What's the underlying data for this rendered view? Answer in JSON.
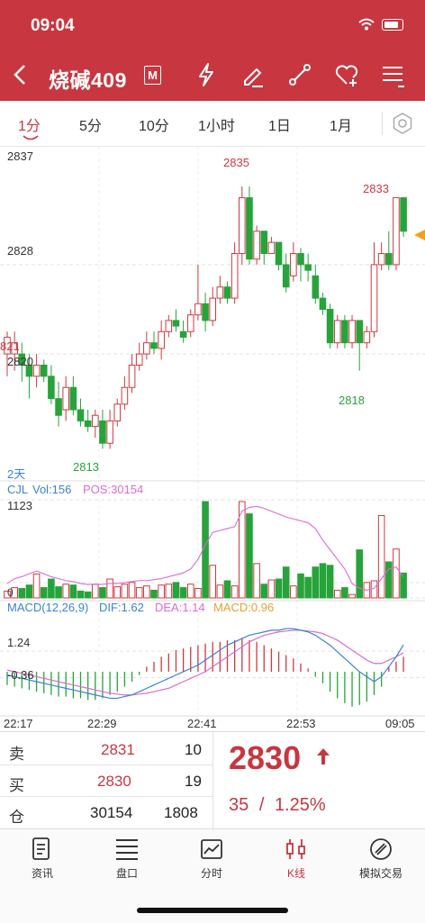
{
  "status": {
    "time": "09:04"
  },
  "header": {
    "title": "烧碱409",
    "badge": "M"
  },
  "tabs": [
    "1分",
    "5分",
    "10分",
    "1小时",
    "1日",
    "1月"
  ],
  "chart": {
    "price_ticks": [
      "2837",
      "2828",
      "2820"
    ],
    "left_cut_label": "821",
    "high1": "2835",
    "high2": "2833",
    "low1": "2813",
    "low2": "2818",
    "period_label": "2天",
    "vol_legend": {
      "name": "CJL",
      "vol": "Vol:156",
      "pos": "POS:30154"
    },
    "vol_max": "1123",
    "vol_zero": "0",
    "macd_legend": {
      "name": "MACD(12,26,9)",
      "dif": "DIF:1.62",
      "dea": "DEA:1.14",
      "macd": "MACD:0.96"
    },
    "macd_ticks": [
      "1.24",
      "-0.36"
    ],
    "time_labels": [
      "22:17",
      "22:29",
      "22:41",
      "22:53",
      "09:05"
    ]
  },
  "chart_data": {
    "type": "candlestick",
    "price_range": [
      2810,
      2838
    ],
    "candles": [
      [
        2820,
        2821.5,
        2818,
        2822
      ],
      [
        2820,
        2821,
        2818.5,
        2822
      ],
      [
        2820,
        2819,
        2817.5,
        2821
      ],
      [
        2819,
        2818,
        2816,
        2820
      ],
      [
        2818,
        2819,
        2817,
        2820
      ],
      [
        2819,
        2818,
        2817.5,
        2819.5
      ],
      [
        2818,
        2816,
        2815.5,
        2819
      ],
      [
        2816,
        2814.5,
        2813.5,
        2817.5
      ],
      [
        2815,
        2817,
        2814,
        2818
      ],
      [
        2817,
        2815,
        2814.5,
        2818
      ],
      [
        2815,
        2814,
        2813.5,
        2816
      ],
      [
        2814,
        2813.5,
        2813,
        2815
      ],
      [
        2813.5,
        2814.5,
        2812.5,
        2815
      ],
      [
        2814,
        2812,
        2811.5,
        2815
      ],
      [
        2812,
        2814,
        2811.5,
        2815
      ],
      [
        2814,
        2815.5,
        2813.5,
        2816
      ],
      [
        2815.5,
        2817,
        2815,
        2818
      ],
      [
        2817,
        2819,
        2816.5,
        2820
      ],
      [
        2819,
        2820,
        2818.5,
        2821
      ],
      [
        2820,
        2821,
        2819.5,
        2822
      ],
      [
        2821,
        2820.5,
        2820,
        2822
      ],
      [
        2820.5,
        2822,
        2819.5,
        2823
      ],
      [
        2822,
        2823,
        2821.5,
        2823.5
      ],
      [
        2823,
        2822.5,
        2822,
        2824
      ],
      [
        2822,
        2821.5,
        2821,
        2823
      ],
      [
        2822,
        2823.5,
        2821.5,
        2824
      ],
      [
        2823.5,
        2824.5,
        2823,
        2828
      ],
      [
        2824.5,
        2823,
        2822,
        2825.5
      ],
      [
        2823,
        2825,
        2822.5,
        2826
      ],
      [
        2825,
        2826,
        2824.5,
        2827
      ],
      [
        2826,
        2825,
        2824.5,
        2826.5
      ],
      [
        2825,
        2829,
        2824.5,
        2830
      ],
      [
        2829,
        2834,
        2828,
        2835
      ],
      [
        2834,
        2828.5,
        2828,
        2835
      ],
      [
        2828.5,
        2831,
        2828,
        2831.5
      ],
      [
        2831,
        2829,
        2828,
        2831
      ],
      [
        2829,
        2830,
        2829,
        2830.5
      ],
      [
        2830,
        2828,
        2827.5,
        2830
      ],
      [
        2828,
        2826,
        2825.5,
        2829
      ],
      [
        2827,
        2829,
        2826.5,
        2830
      ],
      [
        2829,
        2828,
        2826.5,
        2829.5
      ],
      [
        2828,
        2827.5,
        2826.5,
        2829
      ],
      [
        2827,
        2825,
        2824.5,
        2828
      ],
      [
        2825,
        2824,
        2823.5,
        2825.5
      ],
      [
        2824,
        2821,
        2820.5,
        2824.5
      ],
      [
        2821,
        2823,
        2820.5,
        2823.5
      ],
      [
        2823,
        2821,
        2820.5,
        2823.5
      ],
      [
        2821,
        2823,
        2820.5,
        2823.5
      ],
      [
        2823,
        2821,
        2818.5,
        2823
      ],
      [
        2821,
        2822,
        2820.5,
        2822.5
      ],
      [
        2822,
        2828,
        2821.5,
        2830
      ],
      [
        2828,
        2829,
        2827.5,
        2830
      ],
      [
        2829,
        2828,
        2827.5,
        2831
      ],
      [
        2828,
        2834,
        2827.5,
        2834
      ],
      [
        2834,
        2831,
        2830.5,
        2834
      ]
    ],
    "volumes": [
      80,
      120,
      110,
      150,
      280,
      120,
      220,
      130,
      160,
      150,
      80,
      70,
      160,
      120,
      220,
      130,
      160,
      180,
      120,
      140,
      90,
      150,
      160,
      180,
      120,
      160,
      110,
      1123,
      380,
      150,
      200,
      140,
      1123,
      980,
      400,
      160,
      210,
      220,
      360,
      140,
      280,
      240,
      360,
      400,
      380,
      90,
      120,
      40,
      560,
      180,
      200,
      960,
      420,
      570,
      290
    ],
    "macd_hist": [
      -0.8,
      -0.9,
      -1.0,
      -1.1,
      -1.2,
      -1.3,
      -1.4,
      -1.5,
      -1.5,
      -1.6,
      -1.6,
      -1.7,
      -1.7,
      -1.6,
      -1.4,
      -1.2,
      -0.9,
      -0.6,
      -0.2,
      0.3,
      0.6,
      0.9,
      1.1,
      1.3,
      1.4,
      1.5,
      1.6,
      1.7,
      1.8,
      1.8,
      1.9,
      1.9,
      2.0,
      1.9,
      1.8,
      1.6,
      1.4,
      1.2,
      1.0,
      0.8,
      0.5,
      0.2,
      -0.3,
      -0.7,
      -1.2,
      -1.6,
      -1.9,
      -2.1,
      -2.0,
      -1.8,
      -1.4,
      -0.9,
      0.3,
      0.6,
      0.9
    ],
    "dif": [
      -0.2,
      -0.3,
      -0.4,
      -0.5,
      -0.6,
      -0.7,
      -0.8,
      -0.9,
      -1.0,
      -1.1,
      -1.2,
      -1.3,
      -1.4,
      -1.5,
      -1.6,
      -1.6,
      -1.5,
      -1.4,
      -1.2,
      -1.0,
      -0.8,
      -0.6,
      -0.4,
      -0.2,
      0.0,
      0.2,
      0.4,
      0.7,
      1.0,
      1.3,
      1.6,
      1.8,
      2.0,
      2.2,
      2.3,
      2.4,
      2.5,
      2.5,
      2.6,
      2.6,
      2.5,
      2.4,
      2.2,
      1.9,
      1.6,
      1.2,
      0.8,
      0.4,
      0.0,
      -0.3,
      -0.6,
      -0.3,
      0.3,
      0.9,
      1.62
    ],
    "dea": [
      0.1,
      0.0,
      -0.1,
      -0.2,
      -0.3,
      -0.4,
      -0.5,
      -0.6,
      -0.7,
      -0.8,
      -0.9,
      -1.0,
      -1.1,
      -1.2,
      -1.3,
      -1.35,
      -1.4,
      -1.4,
      -1.35,
      -1.3,
      -1.2,
      -1.1,
      -1.0,
      -0.8,
      -0.6,
      -0.4,
      -0.2,
      0.0,
      0.3,
      0.6,
      0.9,
      1.2,
      1.5,
      1.8,
      2.0,
      2.2,
      2.3,
      2.4,
      2.45,
      2.5,
      2.5,
      2.45,
      2.4,
      2.3,
      2.1,
      1.9,
      1.6,
      1.3,
      1.0,
      0.7,
      0.5,
      0.5,
      0.7,
      0.9,
      1.14
    ],
    "macd_range": [
      -2.5,
      3.2
    ],
    "vol_range": [
      0,
      1123
    ]
  },
  "quote": {
    "rows": [
      {
        "label": "卖",
        "price": "2831",
        "qty": "10"
      },
      {
        "label": "买",
        "price": "2830",
        "qty": "19"
      },
      {
        "label": "仓",
        "price": "30154",
        "qty": "1808"
      }
    ],
    "last": "2830",
    "change": "35",
    "sep": "/",
    "pct": "1.25%"
  },
  "bottom_tabs": [
    "资讯",
    "盘口",
    "分时",
    "K线",
    "模拟交易"
  ],
  "colors": {
    "accent": "#c8363f",
    "up": "#d0383f",
    "down": "#27a33b",
    "dif": "#3b82d6",
    "dea": "#d96cd3"
  }
}
